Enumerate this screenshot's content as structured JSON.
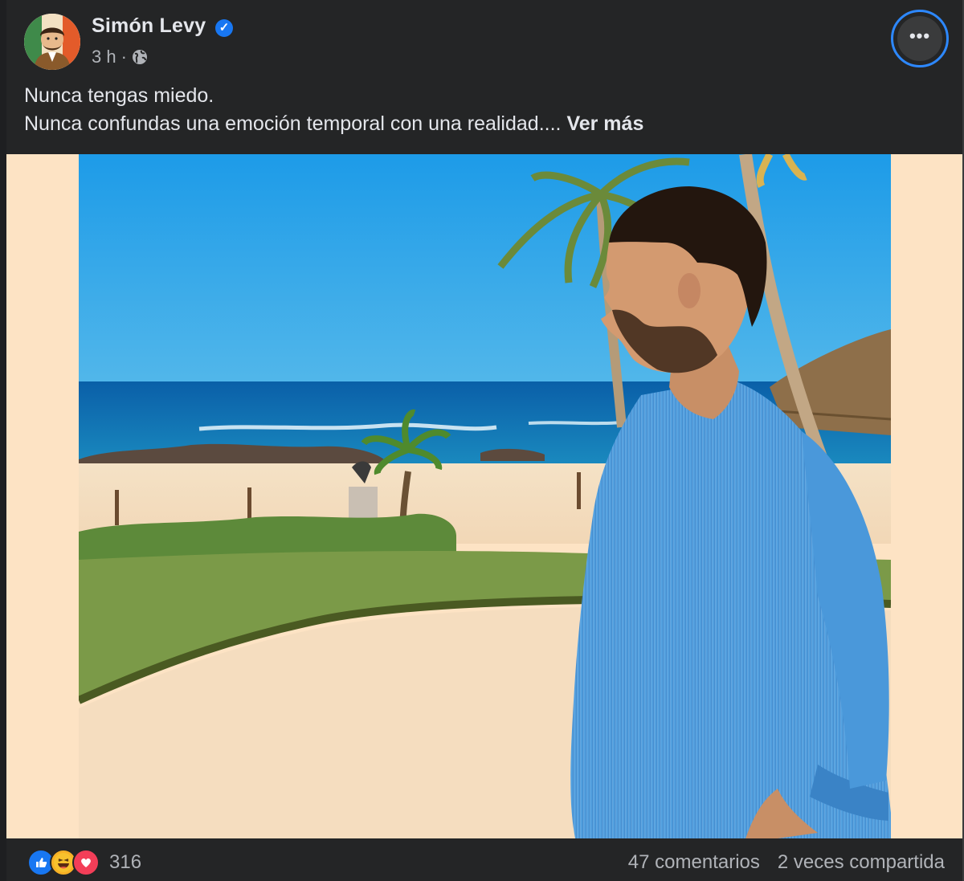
{
  "post": {
    "author": "Simón Levy",
    "time": "3 h",
    "separator": "·",
    "text_line1": "Nunca tengas miedo.",
    "text_line2": "Nunca confundas una emoción temporal con una realidad....",
    "see_more": "Ver más",
    "more_icon": "•••"
  },
  "footer": {
    "reaction_icons": [
      "like-icon",
      "haha-icon",
      "love-icon"
    ],
    "reaction_count": "316",
    "comments": "47 comentarios",
    "shares": "2 veces compartida"
  },
  "colors": {
    "background": "#242526",
    "text": "#e4e6eb",
    "secondary_text": "#b0b3b8",
    "accent": "#1877f2",
    "photo_matte": "#fde3c4"
  }
}
